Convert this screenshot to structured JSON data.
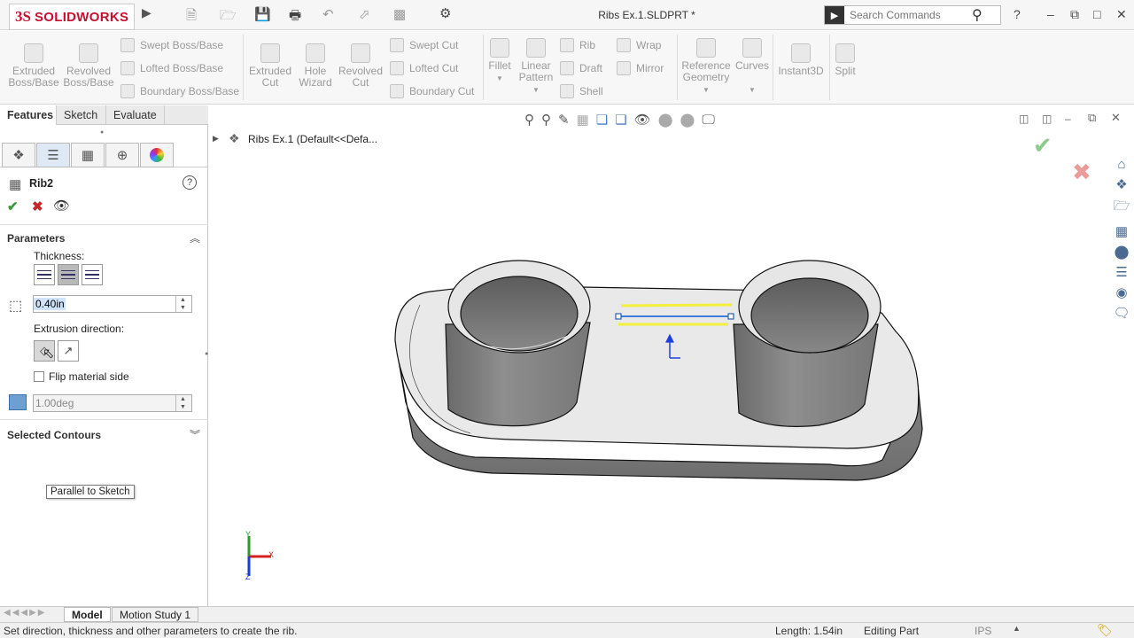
{
  "app": {
    "logo_ds": "3S",
    "logo_name": "SOLIDWORKS",
    "document_title": "Ribs Ex.1.SLDPRT *"
  },
  "search": {
    "placeholder": "Search Commands"
  },
  "titlebar_icons": [
    "new-icon",
    "open-icon",
    "save-icon",
    "print-icon",
    "undo-icon",
    "select-icon",
    "rebuild-icon",
    "options-icon"
  ],
  "window_controls": {
    "help": "?",
    "minimize": "–",
    "restore": "⧉",
    "maximize": "□",
    "close": "✕"
  },
  "ribbon": {
    "extruded_boss": [
      "Extruded",
      "Boss/Base"
    ],
    "revolved_boss": [
      "Revolved",
      "Boss/Base"
    ],
    "swept_boss": "Swept Boss/Base",
    "lofted_boss": "Lofted Boss/Base",
    "boundary_boss": "Boundary Boss/Base",
    "extruded_cut": [
      "Extruded",
      "Cut"
    ],
    "hole_wizard": [
      "Hole",
      "Wizard"
    ],
    "revolved_cut": [
      "Revolved",
      "Cut"
    ],
    "swept_cut": "Swept Cut",
    "lofted_cut": "Lofted Cut",
    "boundary_cut": "Boundary Cut",
    "fillet": "Fillet",
    "linear_pattern": [
      "Linear",
      "Pattern"
    ],
    "rib": "Rib",
    "draft": "Draft",
    "shell": "Shell",
    "wrap": "Wrap",
    "mirror": "Mirror",
    "reference_geometry": [
      "Reference",
      "Geometry"
    ],
    "curves": "Curves",
    "instant3d": "Instant3D",
    "split": "Split"
  },
  "command_tabs": [
    "Features",
    "Sketch",
    "Evaluate"
  ],
  "property_manager": {
    "feature_name": "Rib2",
    "help": "?",
    "parameters_header": "Parameters",
    "thickness_label": "Thickness:",
    "thickness_value": "0.40in",
    "extrusion_direction_label": "Extrusion direction:",
    "flip_material_label": "Flip material side",
    "draft_value": "1.00deg",
    "selected_contours_header": "Selected Contours",
    "tooltip": "Parallel to Sketch"
  },
  "feature_tree": {
    "root": "Ribs Ex.1  (Default<<Defa..."
  },
  "triad": {
    "x": "X",
    "y": "Y",
    "z": "Z"
  },
  "bottom_tabs": [
    "Model",
    "Motion Study 1"
  ],
  "status": {
    "message": "Set direction, thickness and other parameters to create the rib.",
    "length": "Length: 1.54in",
    "mode": "Editing Part",
    "units": "IPS"
  },
  "colors": {
    "accept": "#4caf50",
    "reject": "#d93030",
    "sketch_line": "#3c7fd6",
    "rib_preview": "#f4ee3c",
    "logo": "#c8102e"
  }
}
